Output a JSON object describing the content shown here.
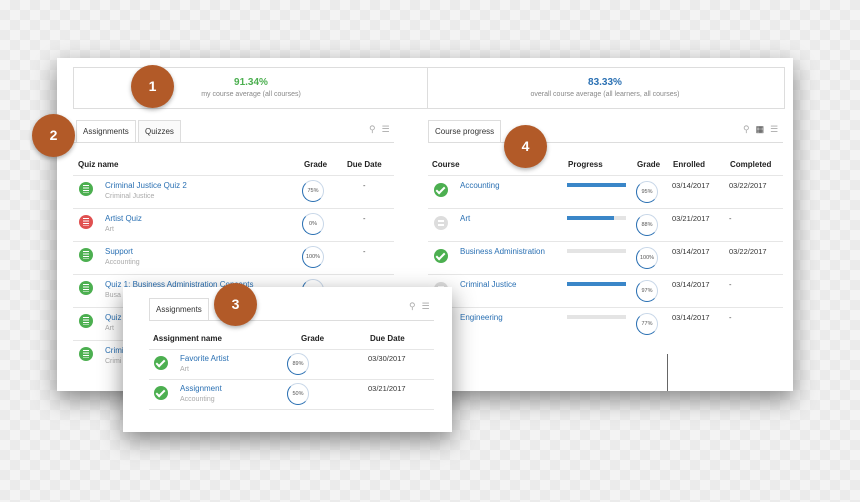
{
  "stats": {
    "my_avg_value": "91.34%",
    "my_avg_label": "my course average (all courses)",
    "overall_avg_value": "83.33%",
    "overall_avg_label": "overall course average (all learners, all courses)",
    "my_color": "#4caf50",
    "overall_color": "#2a70b3"
  },
  "left_panel": {
    "tabs": [
      "Assignments",
      "Quizzes"
    ],
    "headers": {
      "name": "Quiz name",
      "grade": "Grade",
      "due": "Due Date"
    },
    "rows": [
      {
        "title": "Criminal Justice Quiz 2",
        "subtitle": "Criminal Justice",
        "grade": "75%",
        "due": "-",
        "icon": "green"
      },
      {
        "title": "Artist Quiz",
        "subtitle": "Art",
        "grade": "0%",
        "due": "-",
        "icon": "red"
      },
      {
        "title": "Support",
        "subtitle": "Accounting",
        "grade": "100%",
        "due": "-",
        "icon": "green"
      },
      {
        "title": "Quiz 1: Business Administration Concepts",
        "subtitle": "Busa",
        "grade": "",
        "due": "",
        "icon": "green"
      },
      {
        "title": "Quiz",
        "subtitle": "Art",
        "grade": "",
        "due": "",
        "icon": "green"
      },
      {
        "title": "Crimi",
        "subtitle": "Crimi",
        "grade": "",
        "due": "",
        "icon": "green"
      }
    ]
  },
  "right_panel": {
    "tab": "Course progress",
    "headers": {
      "course": "Course",
      "progress": "Progress",
      "grade": "Grade",
      "enrolled": "Enrolled",
      "completed": "Completed"
    },
    "rows": [
      {
        "course": "Accounting",
        "progress": 1.0,
        "grade": "95%",
        "enrolled": "03/14/2017",
        "completed": "03/22/2017",
        "status": "done"
      },
      {
        "course": "Art",
        "progress": 0.8,
        "grade": "88%",
        "enrolled": "03/21/2017",
        "completed": "-",
        "status": "in-progress"
      },
      {
        "course": "Business Administration",
        "progress": 0.0,
        "grade": "100%",
        "enrolled": "03/14/2017",
        "completed": "03/22/2017",
        "status": "done"
      },
      {
        "course": "Criminal Justice",
        "progress": 1.0,
        "grade": "97%",
        "enrolled": "03/14/2017",
        "completed": "-",
        "status": "in-progress"
      },
      {
        "course": "Engineering",
        "progress": 0.0,
        "grade": "77%",
        "enrolled": "03/14/2017",
        "completed": "-",
        "status": "in-progress"
      }
    ]
  },
  "popup": {
    "tab": "Assignments",
    "headers": {
      "name": "Assignment name",
      "grade": "Grade",
      "due": "Due Date"
    },
    "rows": [
      {
        "title": "Favorite Artist",
        "subtitle": "Art",
        "grade": "89%",
        "due": "03/30/2017"
      },
      {
        "title": "Assignment",
        "subtitle": "Accounting",
        "grade": "50%",
        "due": "03/21/2017"
      }
    ]
  },
  "badges": [
    "1",
    "2",
    "3",
    "4"
  ],
  "icons": {
    "search": "search-icon",
    "filter": "filter-icon",
    "grid": "grid-view-icon",
    "list": "list-view-icon"
  }
}
